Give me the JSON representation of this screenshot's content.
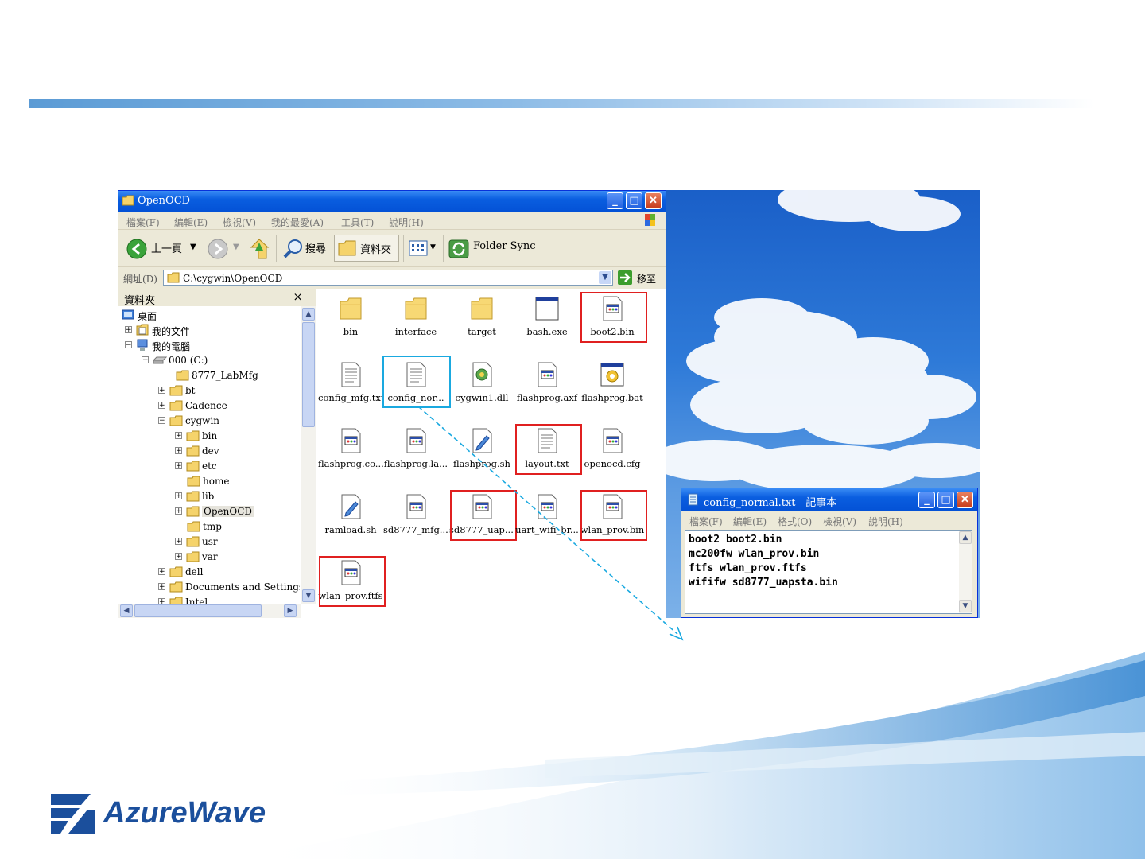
{
  "explorer": {
    "title": "OpenOCD",
    "menu": [
      "檔案(F)",
      "編輯(E)",
      "檢視(V)",
      "我的最愛(A)",
      "工具(T)",
      "說明(H)"
    ],
    "toolbar": {
      "back_label": "上一頁",
      "search_label": "搜尋",
      "folders_label": "資料夾",
      "folder_sync_label": "Folder Sync"
    },
    "address": {
      "label": "網址(D)",
      "value": "C:\\cygwin\\OpenOCD",
      "go_label": "移至"
    },
    "folders_pane": {
      "title": "資料夾",
      "close": "×",
      "tree": [
        {
          "label": "桌面"
        },
        {
          "label": "我的文件"
        },
        {
          "label": "我的電腦"
        },
        {
          "label": "000 (C:)"
        },
        {
          "label": "8777_LabMfg"
        },
        {
          "label": "bt"
        },
        {
          "label": "Cadence"
        },
        {
          "label": "cygwin"
        },
        {
          "label": "bin"
        },
        {
          "label": "dev"
        },
        {
          "label": "etc"
        },
        {
          "label": "home"
        },
        {
          "label": "lib"
        },
        {
          "label": "OpenOCD"
        },
        {
          "label": "tmp"
        },
        {
          "label": "usr"
        },
        {
          "label": "var"
        },
        {
          "label": "dell"
        },
        {
          "label": "Documents and Settings"
        },
        {
          "label": "Intel"
        }
      ]
    },
    "files": [
      {
        "name": "bin",
        "icon": "folder-icon"
      },
      {
        "name": "interface",
        "icon": "folder-icon"
      },
      {
        "name": "target",
        "icon": "folder-icon"
      },
      {
        "name": "bash.exe",
        "icon": "exe-icon"
      },
      {
        "name": "boot2.bin",
        "icon": "binary-file-icon",
        "highlight": "red"
      },
      {
        "name": "config_mfg.txt",
        "icon": "text-file-icon"
      },
      {
        "name": "config_nor...",
        "icon": "text-file-icon",
        "highlight": "blue"
      },
      {
        "name": "cygwin1.dll",
        "icon": "dll-icon"
      },
      {
        "name": "flashprog.axf",
        "icon": "binary-file-icon"
      },
      {
        "name": "flashprog.bat",
        "icon": "batch-file-icon"
      },
      {
        "name": "flashprog.co...",
        "icon": "binary-file-icon"
      },
      {
        "name": "flashprog.la...",
        "icon": "binary-file-icon"
      },
      {
        "name": "flashprog.sh",
        "icon": "script-file-icon"
      },
      {
        "name": "layout.txt",
        "icon": "text-file-icon",
        "highlight": "red"
      },
      {
        "name": "openocd.cfg",
        "icon": "binary-file-icon"
      },
      {
        "name": "ramload.sh",
        "icon": "script-file-icon"
      },
      {
        "name": "sd8777_mfg....",
        "icon": "binary-file-icon"
      },
      {
        "name": "sd8777_uap....",
        "icon": "binary-file-icon",
        "highlight": "red"
      },
      {
        "name": "uart_wifi_br...",
        "icon": "binary-file-icon"
      },
      {
        "name": "wlan_prov.bin",
        "icon": "binary-file-icon",
        "highlight": "red"
      },
      {
        "name": "wlan_prov.ftfs",
        "icon": "binary-file-icon",
        "highlight": "red"
      }
    ]
  },
  "notepad": {
    "title": "config_normal.txt - 記事本",
    "menu": [
      "檔案(F)",
      "編輯(E)",
      "格式(O)",
      "檢視(V)",
      "說明(H)"
    ],
    "lines": [
      "boot2 boot2.bin",
      "mc200fw wlan_prov.bin",
      "ftfs wlan_prov.ftfs",
      "wififw sd8777_uapsta.bin"
    ]
  },
  "logo": {
    "text": "AzureWave"
  },
  "colors": {
    "highlight_red": "#e02020",
    "highlight_blue": "#1aa9e0",
    "xp_blue": "#0a5ee0",
    "brand": "#1b4f9c"
  }
}
